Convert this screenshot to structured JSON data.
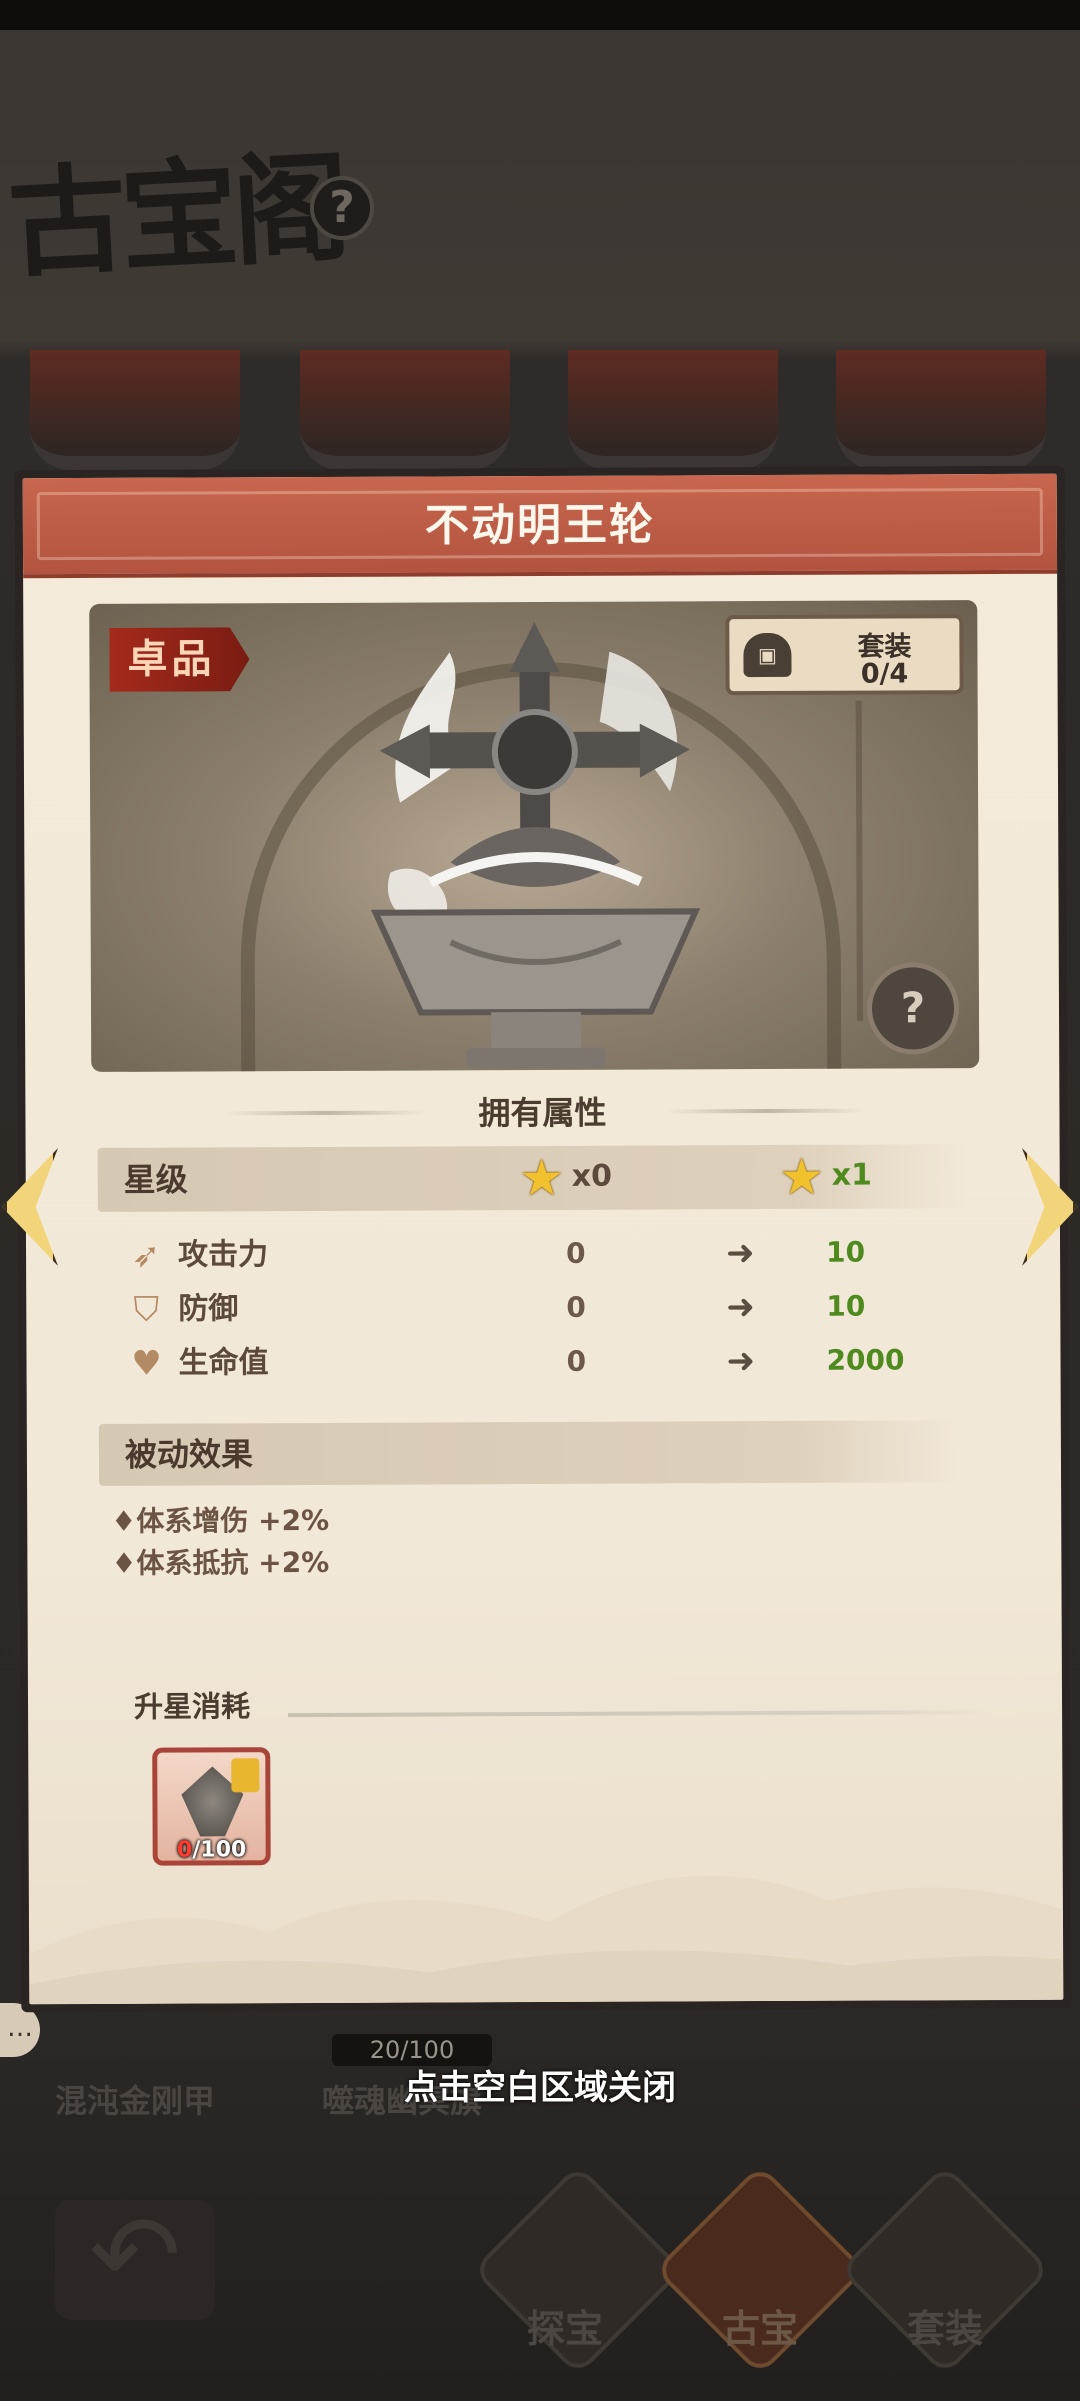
{
  "background": {
    "screen_title": "古宝阁",
    "help_icon": "?",
    "artifact_names": [
      "混沌金刚甲",
      "噬魂幽冥旗"
    ],
    "fragment_counter": "20/100",
    "bottom_tabs": [
      {
        "label": "探宝",
        "icon": "treasure-hunt-icon"
      },
      {
        "label": "古宝",
        "icon": "cauldron-icon",
        "active": true
      },
      {
        "label": "套装",
        "icon": "set-chest-icon"
      }
    ]
  },
  "modal": {
    "title": "不动明王轮",
    "quality_badge": "卓品",
    "set": {
      "label": "套装",
      "count": "0/4"
    },
    "owned_attributes_heading": "拥有属性",
    "star_level": {
      "label": "星级",
      "current": "x0",
      "next": "x1"
    },
    "attributes": [
      {
        "name": "攻击力",
        "icon": "attack-icon",
        "current": "0",
        "next": "10"
      },
      {
        "name": "防御",
        "icon": "shield-icon",
        "current": "0",
        "next": "10"
      },
      {
        "name": "生命值",
        "icon": "heart-icon",
        "current": "0",
        "next": "2000"
      }
    ],
    "passive": {
      "heading": "被动效果",
      "effects": [
        "体系增伤 +2%",
        "体系抵抗 +2%"
      ]
    },
    "upgrade_cost": {
      "heading": "升星消耗",
      "item_have": "0",
      "item_need": "/100"
    }
  },
  "close_hint": "点击空白区域关闭",
  "colors": {
    "header": "#b25440",
    "panel": "#f4ead9",
    "increase_green": "#4e8a1e",
    "star_gold": "#f2c12e",
    "arrow_gold": "#f2d57a"
  }
}
